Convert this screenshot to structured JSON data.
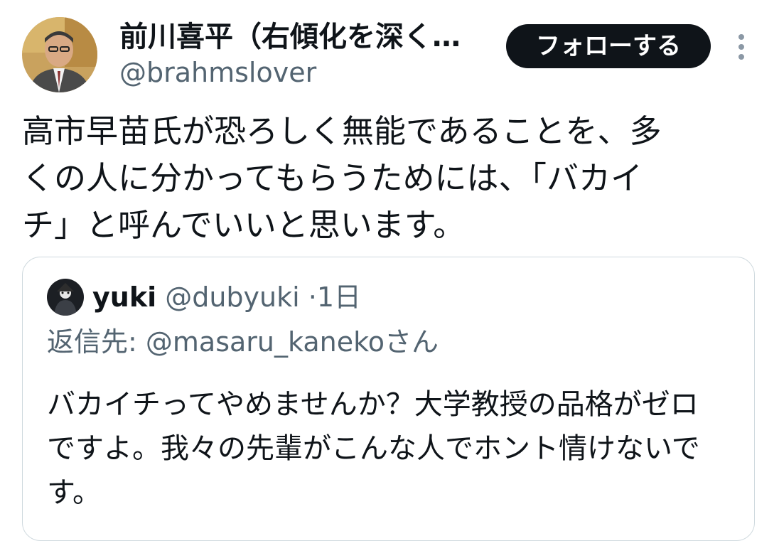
{
  "author": {
    "display_name": "前川喜平（右傾化を深く…",
    "handle": "@brahmslover",
    "avatar_icon": "person-photo-avatar"
  },
  "follow_button": {
    "label": "フォローする"
  },
  "more_menu": {
    "icon": "more-vertical-icon"
  },
  "tweet": {
    "text": "高市早苗氏が恐ろしく無能であることを、多\nくの人に分かってもらうためには、「バカイ\nチ」と呼んでいいと思います。"
  },
  "quoted_tweet": {
    "display_name": "yuki",
    "handle": "@dubyuki",
    "separator": "·",
    "time": "1日",
    "reply_prefix": "返信先: ",
    "reply_mention": "@masaru_kaneko",
    "reply_suffix": "さん",
    "text": "バカイチってやめませんか？大学教授の品格がゼロ\nですよ。我々の先輩がこんな人でホント情けないで\nす。",
    "avatar_icon": "dark-figure-avatar"
  },
  "colors": {
    "text_primary": "#0f1419",
    "text_secondary": "#536471",
    "border": "#cfd9de",
    "button_bg": "#0f1419",
    "button_text": "#ffffff"
  }
}
